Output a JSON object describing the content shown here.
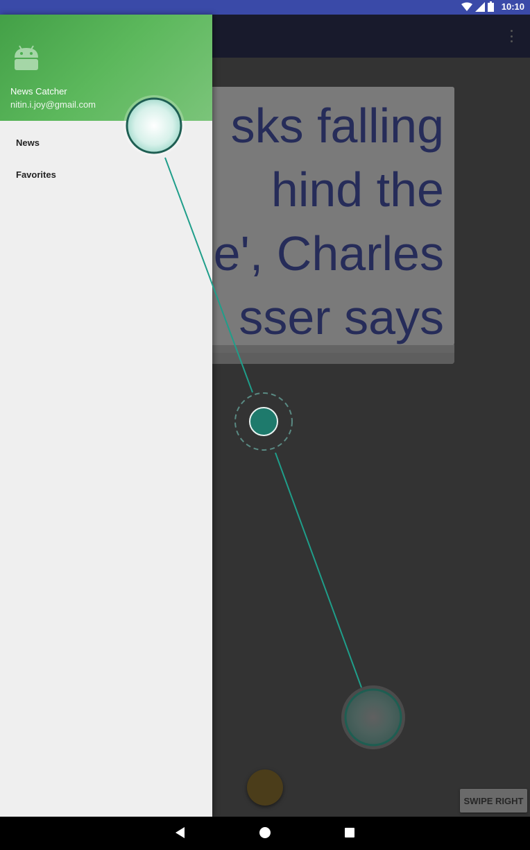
{
  "status_bar": {
    "time": "10:10",
    "icons": [
      "wifi-icon",
      "signal-icon",
      "battery-icon"
    ]
  },
  "app_bar": {
    "overflow_icon": "more-vert-icon"
  },
  "drawer": {
    "app_name": "News Catcher",
    "email": "nitin.i.joy@gmail.com",
    "items": [
      {
        "label": "News"
      },
      {
        "label": "Favorites"
      }
    ]
  },
  "card": {
    "title": "sks falling\nhind the\ne', Charles\nsser says"
  },
  "buttons": {
    "swipe_right": "SWIPE RIGHT"
  },
  "nav_bar": {
    "icons": [
      "back-icon",
      "home-icon",
      "recents-icon"
    ]
  },
  "colors": {
    "status_bar": "#3a4aa8",
    "drawer_header_start": "#43a047",
    "drawer_header_end": "#7bc47a",
    "gesture_stroke": "#1f9e8a",
    "card_text": "#262c59"
  }
}
